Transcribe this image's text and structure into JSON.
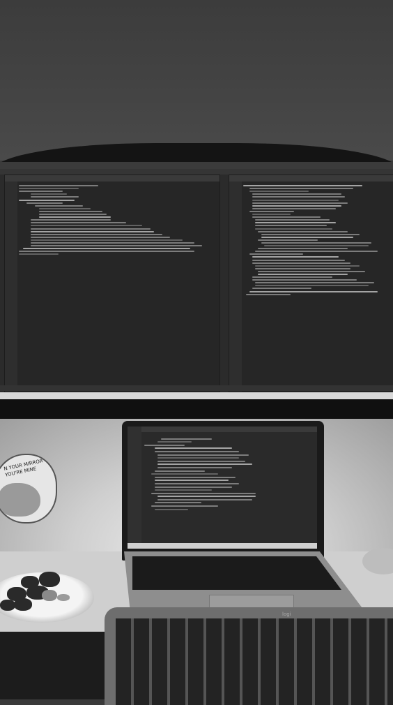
{
  "scene": "photo",
  "monitor": {
    "left_tab_label": "",
    "status_left_text": "",
    "taskbar_text": ""
  },
  "sticker": {
    "line1": "N YOUR MIRROR",
    "line2": "YOU'RE MINE"
  },
  "keyboard_logo": "logi",
  "colors": {
    "screen_bg": "#2b2b2b",
    "code_text": "#9a9a9a",
    "desk": "#cfcfcf"
  }
}
